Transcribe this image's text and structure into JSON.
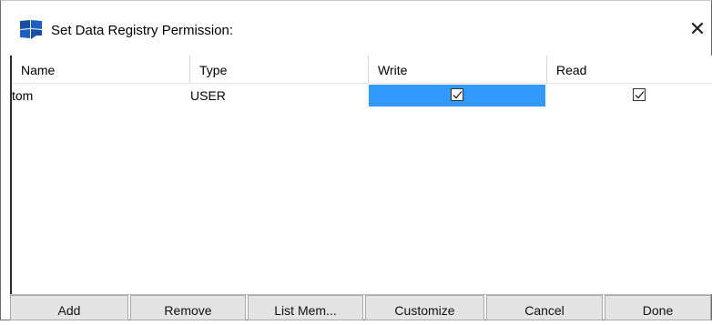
{
  "window": {
    "title": "Set Data Registry Permission:",
    "close_glyph": "✕",
    "icon": "data-registry-icon"
  },
  "table": {
    "columns": [
      "Name",
      "Type",
      "Write",
      "Read"
    ],
    "rows": [
      {
        "name": "tom",
        "type": "USER",
        "write": true,
        "read": true
      }
    ]
  },
  "buttons": {
    "add": "Add",
    "remove": "Remove",
    "list_members": "List Mem...",
    "customize": "Customize",
    "cancel": "Cancel",
    "done": "Done"
  },
  "colors": {
    "selection": "#3399ff",
    "button_bg": "#e4e4e4"
  }
}
